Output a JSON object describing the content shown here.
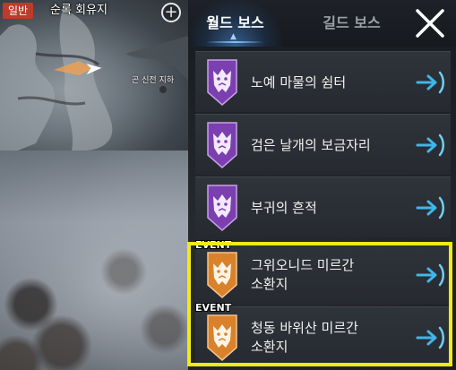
{
  "minimap": {
    "badge": "일반",
    "zone": "순록 회유지",
    "place": "곤 신전 지하",
    "icons": {
      "expand": "plus-circle-icon",
      "player": "player-arrow-icon"
    }
  },
  "tabs": [
    {
      "label": "월드 보스",
      "active": true
    },
    {
      "label": "길드 보스",
      "active": false
    }
  ],
  "close_icon": "close-x-icon",
  "bosses": [
    {
      "name": "노예 마물의 쉼터",
      "type": "world",
      "emblem_color": "#7b3fb0",
      "event": false
    },
    {
      "name": "검은 날개의 보금자리",
      "type": "world",
      "emblem_color": "#7b3fb0",
      "event": false
    },
    {
      "name": "부귀의 흔적",
      "type": "world",
      "emblem_color": "#7b3fb0",
      "event": false
    },
    {
      "name": "그위오니드 미르간\n소환지",
      "type": "event",
      "emblem_color": "#d9822b",
      "event": true,
      "tag": "EVENT"
    },
    {
      "name": "청동 바위산 미르간\n소환지",
      "type": "event",
      "emblem_color": "#d9822b",
      "event": true,
      "tag": "EVENT"
    }
  ],
  "go_icon": "teleport-arrow-icon",
  "colors": {
    "highlight": "#f2ea13",
    "go_arrow": "#3fb6ea",
    "purple": "#7b3fb0",
    "orange": "#d9822b"
  }
}
